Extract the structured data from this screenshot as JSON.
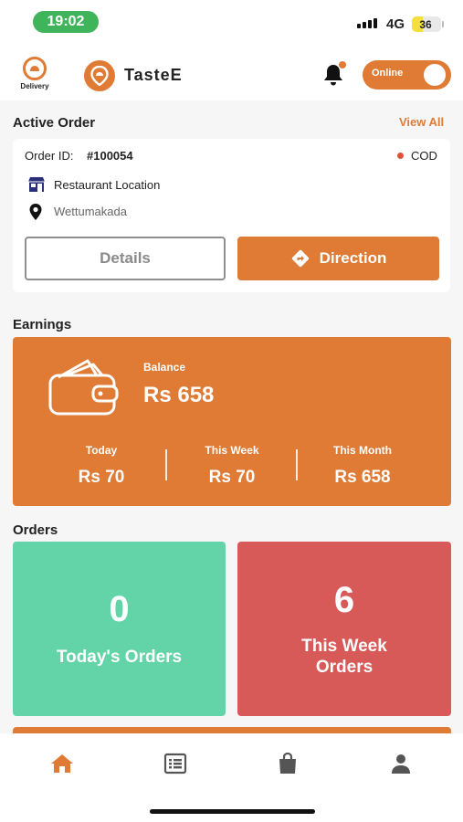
{
  "status_bar": {
    "time": "19:02",
    "network": "4G",
    "battery": "36",
    "battery_level": 0.36
  },
  "header": {
    "delivery_logo_text": "Delivery",
    "brand_name": "TasteE",
    "toggle_label": "Online",
    "toggle_on": true
  },
  "active_order": {
    "title": "Active Order",
    "view_all_label": "View All",
    "order_id_label": "Order ID:",
    "order_id": "#100054",
    "payment_method": "COD",
    "restaurant_location": "Restaurant Location",
    "delivery_location": "Wettumakada",
    "details_label": "Details",
    "direction_label": "Direction"
  },
  "earnings": {
    "title": "Earnings",
    "balance_label": "Balance",
    "balance_value": "Rs 658",
    "stats": [
      {
        "label": "Today",
        "value": "Rs 70"
      },
      {
        "label": "This Week",
        "value": "Rs 70"
      },
      {
        "label": "This Month",
        "value": "Rs 658"
      }
    ]
  },
  "orders": {
    "title": "Orders",
    "cards": [
      {
        "count": "0",
        "label": "Today's Orders"
      },
      {
        "count": "6",
        "label_line1": "This Week",
        "label_line2": "Orders"
      }
    ]
  },
  "bottom_nav": {
    "items": [
      "home-icon",
      "list-icon",
      "shopping-bag-icon",
      "profile-icon"
    ],
    "active": "home-icon"
  },
  "colors": {
    "accent": "#e07b35",
    "green_card": "#63d3a8",
    "red_card": "#d85a58",
    "status_dot": "#e2503a",
    "time_pill": "#3fb45a"
  }
}
